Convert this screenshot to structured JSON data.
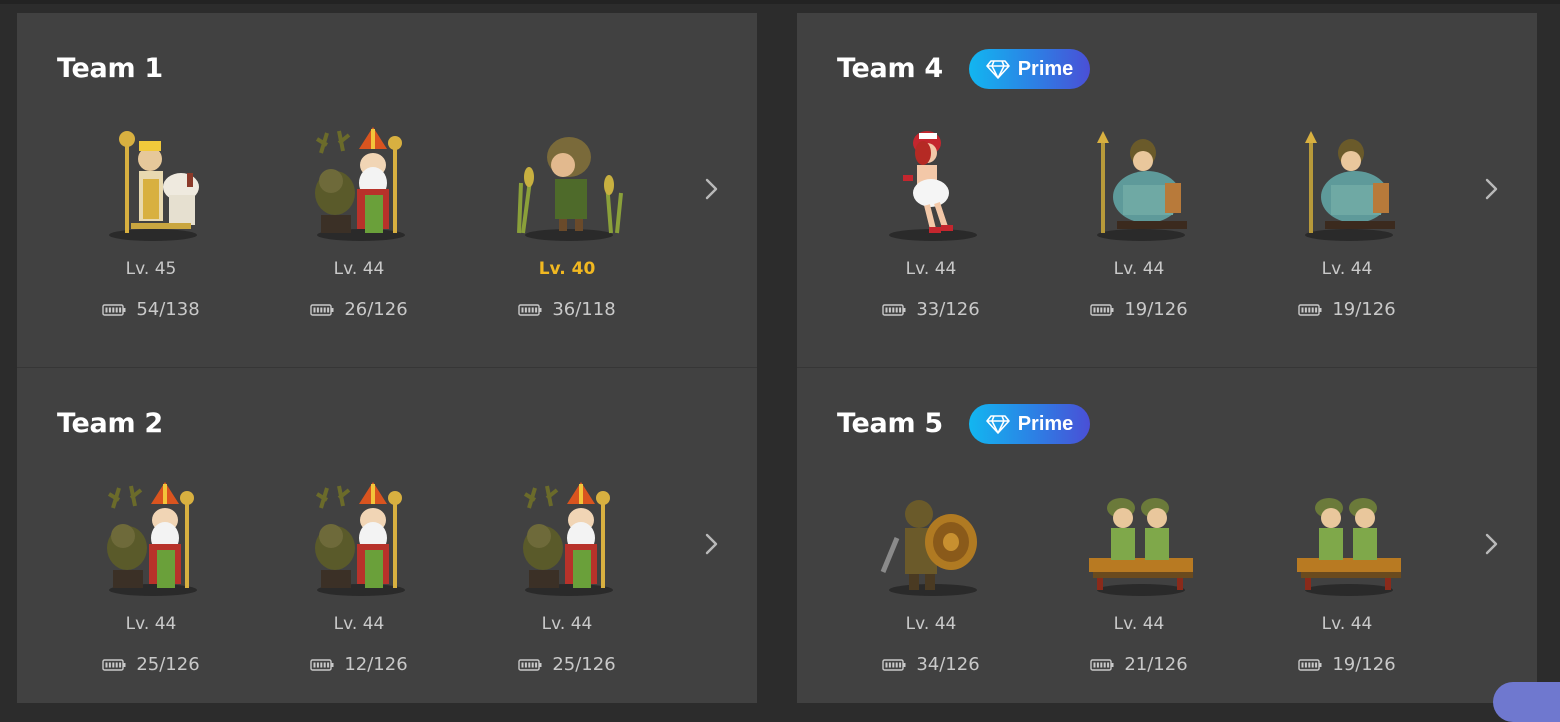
{
  "teams": [
    {
      "title": "Team 1",
      "prime": false,
      "heroes": [
        {
          "sprite": "golden-monk-with-white-beast",
          "level": "Lv. 45",
          "stamina": "54/138",
          "highlight": false
        },
        {
          "sprite": "saint-with-reindeer",
          "level": "Lv. 44",
          "stamina": "26/126",
          "highlight": false
        },
        {
          "sprite": "wheat-farmer-girl",
          "level": "Lv. 40",
          "stamina": "36/118",
          "highlight": true
        }
      ]
    },
    {
      "title": "Team 2",
      "prime": false,
      "heroes": [
        {
          "sprite": "saint-with-reindeer",
          "level": "Lv. 44",
          "stamina": "25/126",
          "highlight": false
        },
        {
          "sprite": "saint-with-reindeer",
          "level": "Lv. 44",
          "stamina": "12/126",
          "highlight": false
        },
        {
          "sprite": "saint-with-reindeer",
          "level": "Lv. 44",
          "stamina": "25/126",
          "highlight": false
        }
      ]
    },
    {
      "title": "Team 4",
      "prime": true,
      "prime_label": "Prime",
      "heroes": [
        {
          "sprite": "red-haired-skater-girl",
          "level": "Lv. 44",
          "stamina": "33/126",
          "highlight": false
        },
        {
          "sprite": "kneeling-staff-monk",
          "level": "Lv. 44",
          "stamina": "19/126",
          "highlight": false
        },
        {
          "sprite": "kneeling-staff-monk",
          "level": "Lv. 44",
          "stamina": "19/126",
          "highlight": false
        }
      ]
    },
    {
      "title": "Team 5",
      "prime": true,
      "prime_label": "Prime",
      "heroes": [
        {
          "sprite": "shield-warrior",
          "level": "Lv. 44",
          "stamina": "34/126",
          "highlight": false
        },
        {
          "sprite": "twin-soldiers-on-cart",
          "level": "Lv. 44",
          "stamina": "21/126",
          "highlight": false
        },
        {
          "sprite": "twin-soldiers-on-cart",
          "level": "Lv. 44",
          "stamina": "19/126",
          "highlight": false
        }
      ]
    }
  ],
  "colors": {
    "panel": "#414141",
    "background": "#2c2c2c",
    "highlight_level": "#f1b821",
    "prime_gradient": [
      "#12b6f0",
      "#4a4fd6"
    ]
  },
  "icons": {
    "stamina": "battery-icon",
    "next": "chevron-right-icon",
    "prime": "diamond-icon"
  }
}
